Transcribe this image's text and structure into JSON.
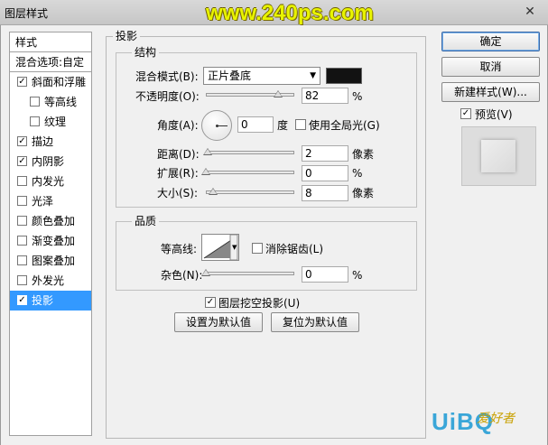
{
  "window": {
    "title": "图层样式",
    "watermark": "www.240ps.com"
  },
  "left_panel": {
    "header1": "样式",
    "header2": "混合选项:自定",
    "items": [
      {
        "label": "斜面和浮雕",
        "checked": true,
        "check_mark": "✓"
      },
      {
        "label": "等高线",
        "checked": false,
        "check_mark": ""
      },
      {
        "label": "纹理",
        "checked": false,
        "check_mark": ""
      },
      {
        "label": "描边",
        "checked": true,
        "check_mark": "✓"
      },
      {
        "label": "内阴影",
        "checked": true,
        "check_mark": "✓"
      },
      {
        "label": "内发光",
        "checked": false,
        "check_mark": ""
      },
      {
        "label": "光泽",
        "checked": false,
        "check_mark": ""
      },
      {
        "label": "颜色叠加",
        "checked": false,
        "check_mark": ""
      },
      {
        "label": "渐变叠加",
        "checked": false,
        "check_mark": ""
      },
      {
        "label": "图案叠加",
        "checked": false,
        "check_mark": ""
      },
      {
        "label": "外发光",
        "checked": false,
        "check_mark": ""
      },
      {
        "label": "投影",
        "checked": true,
        "check_mark": "✓",
        "selected": true
      }
    ]
  },
  "drop_shadow": {
    "section_title": "投影",
    "structure": {
      "title": "结构",
      "blend_mode_label": "混合模式(B):",
      "blend_mode_value": "正片叠底",
      "blend_color": "#121212",
      "opacity_label": "不透明度(O):",
      "opacity_value": "82",
      "opacity_unit": "%",
      "opacity_level": 0.82,
      "angle_label": "角度(A):",
      "angle_value": "0",
      "angle_unit": "度",
      "global_light_label": "使用全局光(G)",
      "global_light_checked": false,
      "distance_label": "距离(D):",
      "distance_value": "2",
      "distance_unit": "像素",
      "spread_label": "扩展(R):",
      "spread_value": "0",
      "spread_unit": "%",
      "size_label": "大小(S):",
      "size_value": "8",
      "size_unit": "像素"
    },
    "quality": {
      "title": "品质",
      "contour_label": "等高线:",
      "anti_alias_label": "消除锯齿(L)",
      "anti_alias_checked": false,
      "noise_label": "杂色(N):",
      "noise_value": "0",
      "noise_unit": "%"
    },
    "knockout_label": "图层挖空投影(U)",
    "knockout_checked": true,
    "knockout_mark": "✓",
    "make_default_label": "设置为默认值",
    "reset_default_label": "复位为默认值"
  },
  "buttons": {
    "ok": "确定",
    "cancel": "取消",
    "new_style": "新建样式(W)..."
  },
  "preview": {
    "label": "预览(V)",
    "checked": true,
    "mark": "✓"
  },
  "footer_logo": {
    "text": "UiBQ",
    "sub": "爱好者"
  }
}
